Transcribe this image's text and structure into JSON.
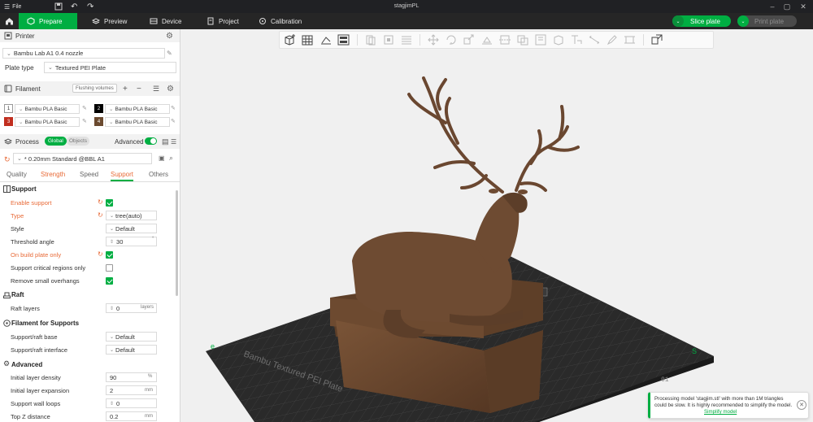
{
  "app": {
    "window_title": "stagjimPL",
    "file_menu": "File"
  },
  "tabs": [
    {
      "label": "Prepare",
      "active": true
    },
    {
      "label": "Preview",
      "active": false
    },
    {
      "label": "Device",
      "active": false
    },
    {
      "label": "Project",
      "active": false
    },
    {
      "label": "Calibration",
      "active": false
    }
  ],
  "actions": {
    "slice_label": "Slice plate",
    "print_label": "Print plate"
  },
  "printer": {
    "section_label": "Printer",
    "name": "Bambu Lab A1 0.4 nozzle",
    "plate_type_label": "Plate type",
    "plate_type_value": "Textured PEI Plate"
  },
  "filament": {
    "section_label": "Filament",
    "flushing_label": "Flushing volumes",
    "slots": [
      {
        "num": "1",
        "name": "Bambu PLA Basic",
        "color": "#ffffff"
      },
      {
        "num": "2",
        "name": "Bambu PLA Basic",
        "color": "#000000"
      },
      {
        "num": "3",
        "name": "Bambu PLA Basic",
        "color": "#c12e1f"
      },
      {
        "num": "4",
        "name": "Bambu PLA Basic",
        "color": "#6b4a2f"
      }
    ]
  },
  "process": {
    "section_label": "Process",
    "global_label": "Global",
    "objects_label": "Objects",
    "advanced_label": "Advanced",
    "preset": "* 0.20mm Standard @BBL A1",
    "subtabs": [
      "Quality",
      "Strength",
      "Speed",
      "Support",
      "Others"
    ]
  },
  "support": {
    "group_label": "Support",
    "enable_support_label": "Enable support",
    "type_label": "Type",
    "type_value": "tree(auto)",
    "style_label": "Style",
    "style_value": "Default",
    "threshold_label": "Threshold angle",
    "threshold_value": "30",
    "build_plate_only_label": "On build plate only",
    "critical_regions_label": "Support critical regions only",
    "remove_overhangs_label": "Remove small overhangs"
  },
  "raft": {
    "group_label": "Raft",
    "layers_label": "Raft layers",
    "layers_value": "0",
    "layers_unit": "layers"
  },
  "filament_supports": {
    "group_label": "Filament for Supports",
    "base_label": "Support/raft base",
    "base_value": "Default",
    "interface_label": "Support/raft interface",
    "interface_value": "Default"
  },
  "advanced": {
    "group_label": "Advanced",
    "initial_density_label": "Initial layer density",
    "initial_density_value": "90",
    "initial_density_unit": "%",
    "initial_expansion_label": "Initial layer expansion",
    "initial_expansion_value": "2",
    "initial_expansion_unit": "mm",
    "wall_loops_label": "Support wall loops",
    "wall_loops_value": "0",
    "top_z_label": "Top Z distance",
    "top_z_value": "0.2",
    "top_z_unit": "mm"
  },
  "plate": {
    "label": "Bambu Textured PEI Plate",
    "plate_number": "01"
  },
  "notification": {
    "text": "Processing model 'stagjim.stl' with more than 1M triangles could be slow. It is highly recommended to simplify the model.",
    "link": "Simplify model"
  },
  "colors": {
    "accent": "#00ae42",
    "warning_text": "#e86a37",
    "model": "#6b4a2f",
    "tab_bar": "#262626"
  }
}
